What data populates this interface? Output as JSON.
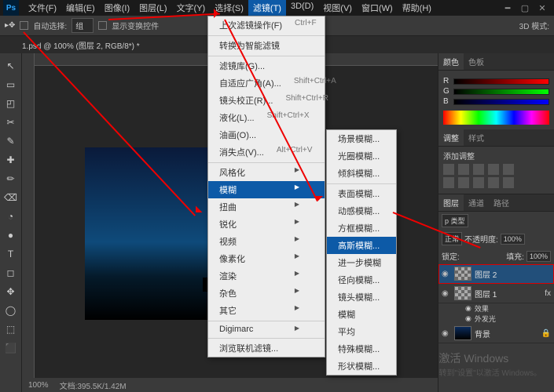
{
  "app": {
    "icon_label": "Ps"
  },
  "menubar": {
    "items": [
      "文件(F)",
      "编辑(E)",
      "图像(I)",
      "图层(L)",
      "文字(Y)",
      "选择(S)",
      "滤镜(T)",
      "3D(D)",
      "视图(V)",
      "窗口(W)",
      "帮助(H)"
    ],
    "highlighted_index": 6
  },
  "options_bar": {
    "auto_select_label": "自动选择:",
    "auto_select_value": "组",
    "show_transform_label": "显示变换控件",
    "mode_3d_label": "3D 模式:"
  },
  "tab": {
    "title": "1.psd @ 100% (图层 2, RGB/8*) *"
  },
  "filter_menu": {
    "items": [
      {
        "label": "上次滤镜操作(F)",
        "shortcut": "Ctrl+F"
      },
      {
        "label": "转换为智能滤镜",
        "sep": true
      },
      {
        "label": "滤镜库(G)...",
        "sep": true
      },
      {
        "label": "自适应广角(A)...",
        "shortcut": "Shift+Ctrl+A"
      },
      {
        "label": "镜头校正(R)...",
        "shortcut": "Shift+Ctrl+R"
      },
      {
        "label": "液化(L)...",
        "shortcut": "Shift+Ctrl+X"
      },
      {
        "label": "油画(O)..."
      },
      {
        "label": "消失点(V)...",
        "shortcut": "Alt+Ctrl+V"
      },
      {
        "label": "风格化",
        "sub": true,
        "sep": true
      },
      {
        "label": "模糊",
        "sub": true,
        "hl": true
      },
      {
        "label": "扭曲",
        "sub": true
      },
      {
        "label": "锐化",
        "sub": true
      },
      {
        "label": "视频",
        "sub": true
      },
      {
        "label": "像素化",
        "sub": true
      },
      {
        "label": "渲染",
        "sub": true
      },
      {
        "label": "杂色",
        "sub": true
      },
      {
        "label": "其它",
        "sub": true
      },
      {
        "label": "Digimarc",
        "sub": true,
        "sep": true
      },
      {
        "label": "浏览联机滤镜...",
        "sep": true
      }
    ]
  },
  "blur_submenu": {
    "items": [
      {
        "label": "场景模糊..."
      },
      {
        "label": "光圈模糊..."
      },
      {
        "label": "倾斜模糊..."
      },
      {
        "label": "表面模糊...",
        "sep": true
      },
      {
        "label": "动感模糊..."
      },
      {
        "label": "方框模糊..."
      },
      {
        "label": "高斯模糊...",
        "hl": true
      },
      {
        "label": "进一步模糊"
      },
      {
        "label": "径向模糊..."
      },
      {
        "label": "镜头模糊..."
      },
      {
        "label": "模糊"
      },
      {
        "label": "平均"
      },
      {
        "label": "特殊模糊..."
      },
      {
        "label": "形状模糊..."
      }
    ]
  },
  "color_panel": {
    "tabs": [
      "颜色",
      "色板"
    ],
    "channels": [
      "R",
      "G",
      "B"
    ],
    "values": [
      "",
      "",
      ""
    ]
  },
  "adjust_panel": {
    "tabs": [
      "调整",
      "样式"
    ],
    "title": "添加调整"
  },
  "layers_panel": {
    "tabs": [
      "图层",
      "通道",
      "路径"
    ],
    "kind_label": "p 类型",
    "blend_mode": "正常",
    "opacity_label": "不透明度:",
    "opacity_value": "100%",
    "lock_label": "锁定:",
    "fill_label": "填充:",
    "fill_value": "100%",
    "layers": [
      {
        "name": "图层 2",
        "visible": true,
        "selected": true,
        "thumb": "cb"
      },
      {
        "name": "图层 1",
        "visible": true,
        "fx": "fx",
        "thumb": "cb"
      },
      {
        "name": "背景",
        "visible": true,
        "locked": true,
        "thumb": "img"
      }
    ],
    "fx_group_label": "效果",
    "fx_item_label": "外发光"
  },
  "statusbar": {
    "zoom": "100%",
    "doc": "文档:395.5K/1.42M"
  },
  "watermark": {
    "line1": "激活 Windows",
    "line2": "转到\"设置\"以激活 Windows。"
  },
  "tools": [
    "↖",
    "▭",
    "◰",
    "✂",
    "✎",
    "✚",
    "✏",
    "⌫",
    "◔",
    "●",
    "T",
    "◻",
    "✥",
    "◯",
    "⬚",
    "⬛"
  ]
}
